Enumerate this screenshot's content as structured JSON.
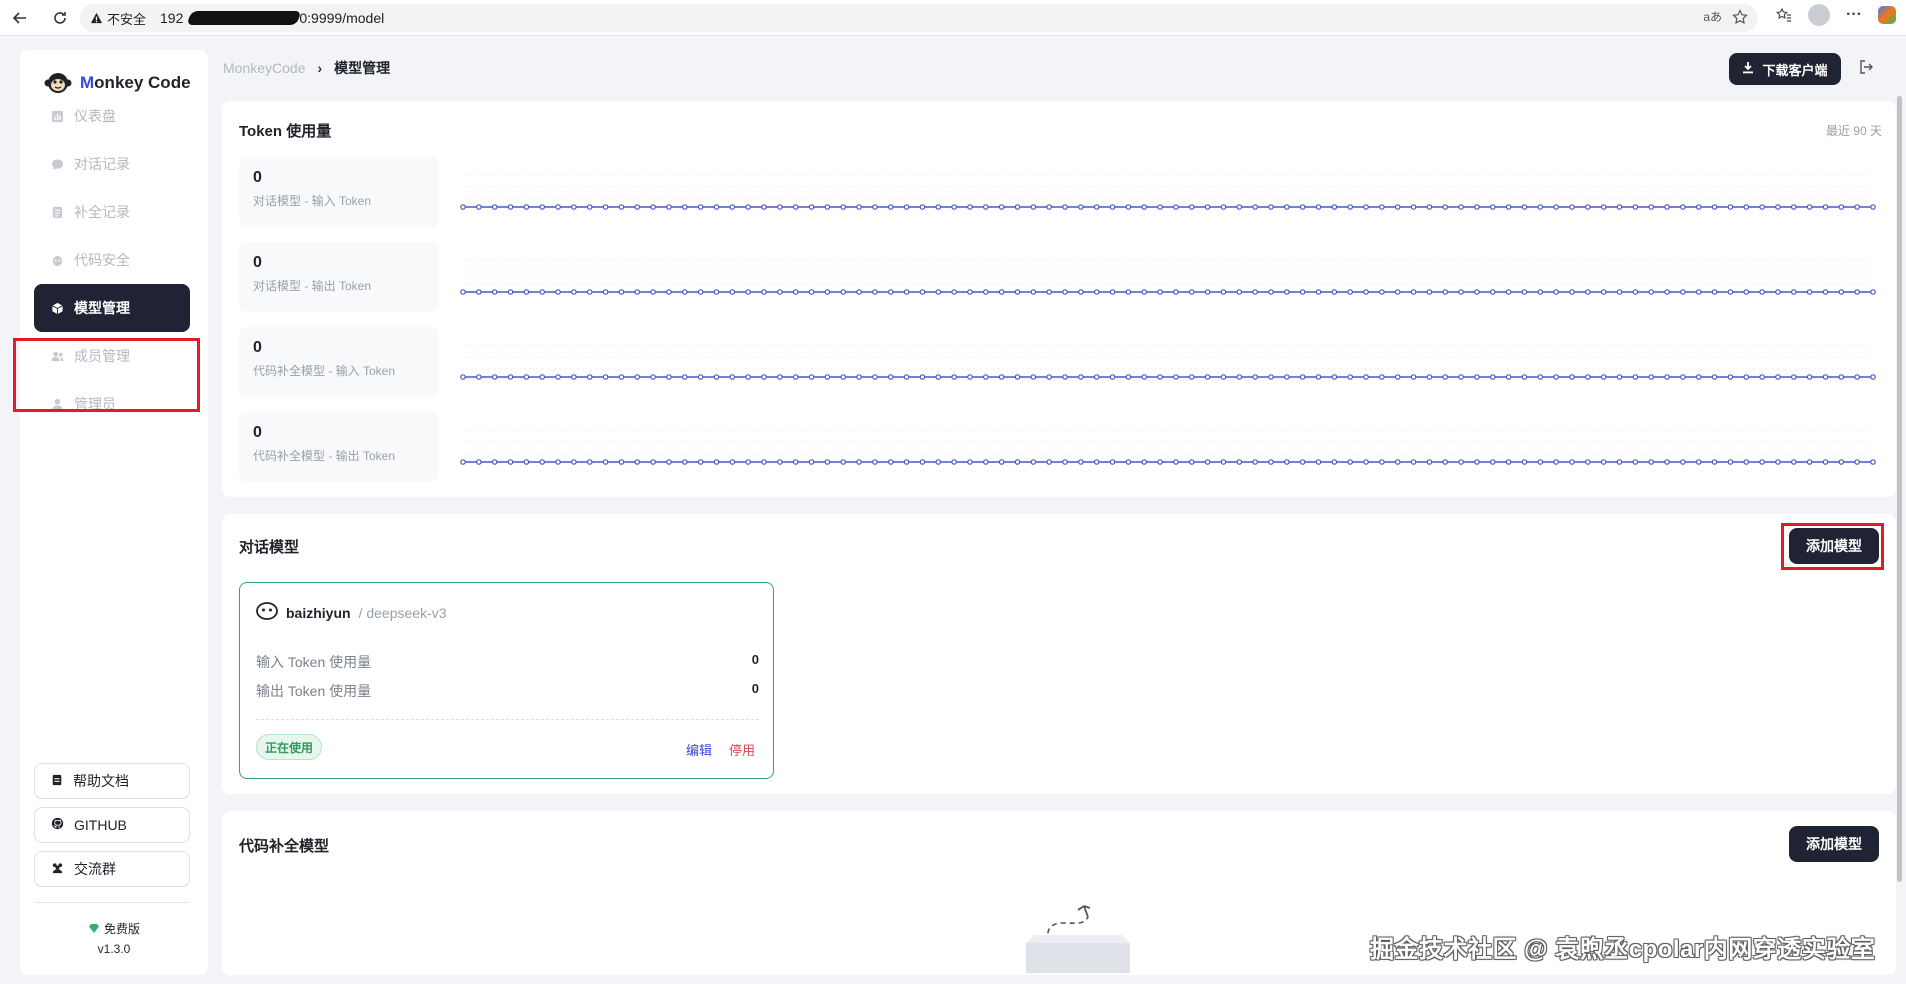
{
  "browser": {
    "insecure_label": "不安全",
    "url_prefix": "192",
    "url_suffix": "0:9999/model"
  },
  "sidebar": {
    "brand_m": "M",
    "brand_rest": "onkey Code",
    "items": [
      {
        "label": "仪表盘",
        "icon": "dashboard-icon"
      },
      {
        "label": "对话记录",
        "icon": "chat-icon"
      },
      {
        "label": "补全记录",
        "icon": "document-icon"
      },
      {
        "label": "代码安全",
        "icon": "bug-icon"
      },
      {
        "label": "模型管理",
        "icon": "cube-icon",
        "active": true
      },
      {
        "label": "成员管理",
        "icon": "users-icon"
      },
      {
        "label": "管理员",
        "icon": "admin-icon"
      }
    ],
    "help_label": "帮助文档",
    "github_label": "GITHUB",
    "group_label": "交流群",
    "plan_label": "免费版",
    "version": "v1.3.0"
  },
  "header": {
    "breadcrumb_root": "MonkeyCode",
    "breadcrumb_sep": "›",
    "breadcrumb_current": "模型管理",
    "download_label": "下载客户端"
  },
  "token_usage": {
    "title": "Token 使用量",
    "range": "最近 90 天",
    "stats": [
      {
        "value": "0",
        "label": "对话模型 - 输入 Token"
      },
      {
        "value": "0",
        "label": "对话模型 - 输出 Token"
      },
      {
        "value": "0",
        "label": "代码补全模型 - 输入 Token"
      },
      {
        "value": "0",
        "label": "代码补全模型 - 输出 Token"
      }
    ],
    "line_color": "#4a55c8"
  },
  "chat_models": {
    "title": "对话模型",
    "add_label": "添加模型",
    "model": {
      "provider": "baizhiyun",
      "name": "/ deepseek-v3",
      "input_label": "输入 Token 使用量",
      "input_value": "0",
      "output_label": "输出 Token 使用量",
      "output_value": "0",
      "status": "正在使用",
      "edit_label": "编辑",
      "disable_label": "停用"
    }
  },
  "completion_models": {
    "title": "代码补全模型",
    "add_label": "添加模型"
  },
  "watermark": "掘金技术社区 @ 袁煦丞cpolar内网穿透实验室",
  "colors": {
    "dark": "#1f2333",
    "accent": "#3a48d8",
    "highlight": "#e11c25",
    "green": "#39a36e",
    "edit": "#3a48d8",
    "danger": "#e0454f"
  }
}
